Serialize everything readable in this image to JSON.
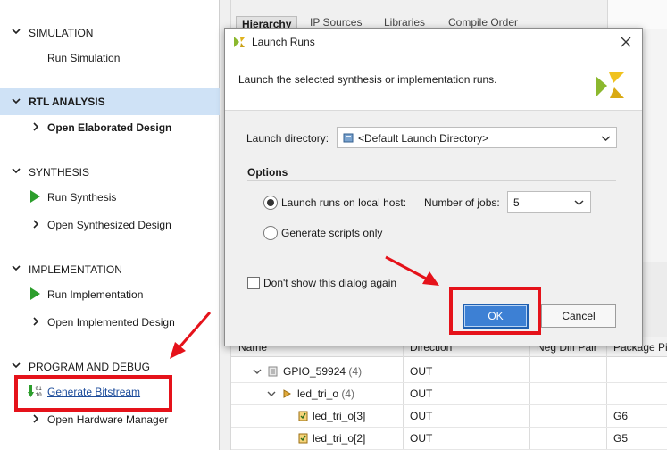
{
  "flow_navigator": {
    "simulation": {
      "title": "SIMULATION",
      "items": [
        "Run Simulation"
      ]
    },
    "rtl_analysis": {
      "title": "RTL ANALYSIS",
      "items": [
        "Open Elaborated Design"
      ]
    },
    "synthesis": {
      "title": "SYNTHESIS",
      "items": [
        "Run Synthesis",
        "Open Synthesized Design"
      ]
    },
    "implementation": {
      "title": "IMPLEMENTATION",
      "items": [
        "Run Implementation",
        "Open Implemented Design"
      ]
    },
    "program_and_debug": {
      "title": "PROGRAM AND DEBUG",
      "items": [
        "Generate Bitstream",
        "Open Hardware Manager"
      ]
    }
  },
  "background": {
    "tabs": [
      "Hierarchy",
      "IP Sources",
      "Libraries",
      "Compile Order"
    ],
    "table": {
      "columns": [
        "Name",
        "Direction",
        "Neg Diff Pair",
        "Package Pi"
      ],
      "rows": [
        {
          "name": "GPIO_59924",
          "count": "(4)",
          "direction": "OUT",
          "package_pin": ""
        },
        {
          "name": "led_tri_o",
          "count": "(4)",
          "direction": "OUT",
          "package_pin": ""
        },
        {
          "name": "led_tri_o[3]",
          "count": "",
          "direction": "OUT",
          "package_pin": "G6"
        },
        {
          "name": "led_tri_o[2]",
          "count": "",
          "direction": "OUT",
          "package_pin": "G5"
        }
      ]
    }
  },
  "dialog": {
    "title": "Launch Runs",
    "description": "Launch the selected synthesis or implementation runs.",
    "launch_directory": {
      "label": "Launch directory:",
      "value": "<Default Launch Directory>"
    },
    "options": {
      "title": "Options",
      "local_host_label": "Launch runs on local host:",
      "jobs_label": "Number of jobs:",
      "jobs_value": "5",
      "scripts_label": "Generate scripts only",
      "selected": "local_host"
    },
    "dont_show_label": "Don't show this dialog again",
    "dont_show_checked": false,
    "ok_label": "OK",
    "cancel_label": "Cancel"
  },
  "colors": {
    "accent_red": "#e5121a",
    "ok_button": "#3d80d4",
    "highlight_section": "#cfe2f6",
    "run_green": "#2c9e2c"
  }
}
